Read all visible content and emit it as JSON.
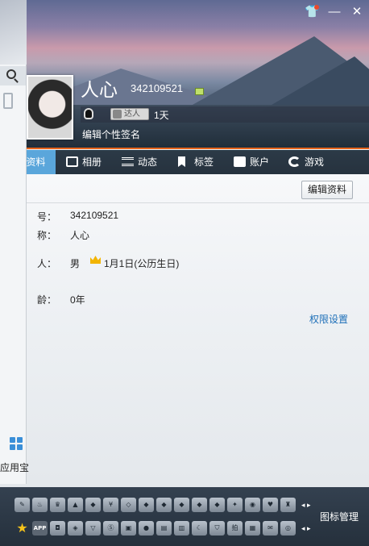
{
  "window": {
    "skin_icon": "shirt-icon",
    "minimize_label": "—",
    "close_label": "✕"
  },
  "profile": {
    "nickname": "人心",
    "qq_number": "342109521",
    "daren_label": "达人",
    "active_days": "1天",
    "signature_placeholder": "编辑个性签名"
  },
  "tabs": [
    {
      "label": "资料",
      "icon": "profile-icon",
      "active": true
    },
    {
      "label": "相册",
      "icon": "album-icon"
    },
    {
      "label": "动态",
      "icon": "feed-icon"
    },
    {
      "label": "标签",
      "icon": "tag-icon"
    },
    {
      "label": "账户",
      "icon": "wallet-icon"
    },
    {
      "label": "游戏",
      "icon": "game-icon"
    }
  ],
  "details": {
    "edit_button": "编辑资料",
    "fields": [
      {
        "label": "号：",
        "value": "342109521"
      },
      {
        "label": "称：",
        "value": "人心"
      },
      {
        "label": "人：",
        "value": "男",
        "extra": "1月1日(公历生日)"
      },
      {
        "label": "龄：",
        "value": "0年"
      }
    ],
    "permission_link": "权限设置"
  },
  "sidebar": {
    "apps_label": "应用宝"
  },
  "bottom_bar": {
    "row1_icons": [
      "quill",
      "flame",
      "crown",
      "pyramid",
      "diamond-red",
      "cash",
      "diamond-white",
      "diamond",
      "diamond",
      "diamond",
      "diamond",
      "diamond",
      "star-badge",
      "mask",
      "heart-badge",
      "trophy"
    ],
    "row2_icons": [
      "star",
      "APP",
      "camera",
      "shield",
      "cup",
      "swirl",
      "box",
      "eye",
      "printer",
      "album",
      "bell",
      "shield-check",
      "pai",
      "docs",
      "mail",
      "qq"
    ],
    "app_label": "APP",
    "star_glyph": "★",
    "pager": "◂ ▸",
    "manage_label": "图标管理"
  }
}
